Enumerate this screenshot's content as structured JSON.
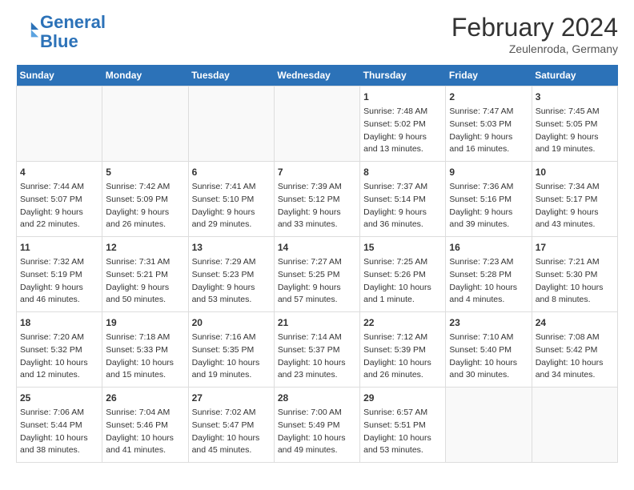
{
  "logo": {
    "line1": "General",
    "line2": "Blue"
  },
  "title": "February 2024",
  "subtitle": "Zeulenroda, Germany",
  "headers": [
    "Sunday",
    "Monday",
    "Tuesday",
    "Wednesday",
    "Thursday",
    "Friday",
    "Saturday"
  ],
  "weeks": [
    [
      {
        "day": "",
        "info": ""
      },
      {
        "day": "",
        "info": ""
      },
      {
        "day": "",
        "info": ""
      },
      {
        "day": "",
        "info": ""
      },
      {
        "day": "1",
        "info": "Sunrise: 7:48 AM\nSunset: 5:02 PM\nDaylight: 9 hours\nand 13 minutes."
      },
      {
        "day": "2",
        "info": "Sunrise: 7:47 AM\nSunset: 5:03 PM\nDaylight: 9 hours\nand 16 minutes."
      },
      {
        "day": "3",
        "info": "Sunrise: 7:45 AM\nSunset: 5:05 PM\nDaylight: 9 hours\nand 19 minutes."
      }
    ],
    [
      {
        "day": "4",
        "info": "Sunrise: 7:44 AM\nSunset: 5:07 PM\nDaylight: 9 hours\nand 22 minutes."
      },
      {
        "day": "5",
        "info": "Sunrise: 7:42 AM\nSunset: 5:09 PM\nDaylight: 9 hours\nand 26 minutes."
      },
      {
        "day": "6",
        "info": "Sunrise: 7:41 AM\nSunset: 5:10 PM\nDaylight: 9 hours\nand 29 minutes."
      },
      {
        "day": "7",
        "info": "Sunrise: 7:39 AM\nSunset: 5:12 PM\nDaylight: 9 hours\nand 33 minutes."
      },
      {
        "day": "8",
        "info": "Sunrise: 7:37 AM\nSunset: 5:14 PM\nDaylight: 9 hours\nand 36 minutes."
      },
      {
        "day": "9",
        "info": "Sunrise: 7:36 AM\nSunset: 5:16 PM\nDaylight: 9 hours\nand 39 minutes."
      },
      {
        "day": "10",
        "info": "Sunrise: 7:34 AM\nSunset: 5:17 PM\nDaylight: 9 hours\nand 43 minutes."
      }
    ],
    [
      {
        "day": "11",
        "info": "Sunrise: 7:32 AM\nSunset: 5:19 PM\nDaylight: 9 hours\nand 46 minutes."
      },
      {
        "day": "12",
        "info": "Sunrise: 7:31 AM\nSunset: 5:21 PM\nDaylight: 9 hours\nand 50 minutes."
      },
      {
        "day": "13",
        "info": "Sunrise: 7:29 AM\nSunset: 5:23 PM\nDaylight: 9 hours\nand 53 minutes."
      },
      {
        "day": "14",
        "info": "Sunrise: 7:27 AM\nSunset: 5:25 PM\nDaylight: 9 hours\nand 57 minutes."
      },
      {
        "day": "15",
        "info": "Sunrise: 7:25 AM\nSunset: 5:26 PM\nDaylight: 10 hours\nand 1 minute."
      },
      {
        "day": "16",
        "info": "Sunrise: 7:23 AM\nSunset: 5:28 PM\nDaylight: 10 hours\nand 4 minutes."
      },
      {
        "day": "17",
        "info": "Sunrise: 7:21 AM\nSunset: 5:30 PM\nDaylight: 10 hours\nand 8 minutes."
      }
    ],
    [
      {
        "day": "18",
        "info": "Sunrise: 7:20 AM\nSunset: 5:32 PM\nDaylight: 10 hours\nand 12 minutes."
      },
      {
        "day": "19",
        "info": "Sunrise: 7:18 AM\nSunset: 5:33 PM\nDaylight: 10 hours\nand 15 minutes."
      },
      {
        "day": "20",
        "info": "Sunrise: 7:16 AM\nSunset: 5:35 PM\nDaylight: 10 hours\nand 19 minutes."
      },
      {
        "day": "21",
        "info": "Sunrise: 7:14 AM\nSunset: 5:37 PM\nDaylight: 10 hours\nand 23 minutes."
      },
      {
        "day": "22",
        "info": "Sunrise: 7:12 AM\nSunset: 5:39 PM\nDaylight: 10 hours\nand 26 minutes."
      },
      {
        "day": "23",
        "info": "Sunrise: 7:10 AM\nSunset: 5:40 PM\nDaylight: 10 hours\nand 30 minutes."
      },
      {
        "day": "24",
        "info": "Sunrise: 7:08 AM\nSunset: 5:42 PM\nDaylight: 10 hours\nand 34 minutes."
      }
    ],
    [
      {
        "day": "25",
        "info": "Sunrise: 7:06 AM\nSunset: 5:44 PM\nDaylight: 10 hours\nand 38 minutes."
      },
      {
        "day": "26",
        "info": "Sunrise: 7:04 AM\nSunset: 5:46 PM\nDaylight: 10 hours\nand 41 minutes."
      },
      {
        "day": "27",
        "info": "Sunrise: 7:02 AM\nSunset: 5:47 PM\nDaylight: 10 hours\nand 45 minutes."
      },
      {
        "day": "28",
        "info": "Sunrise: 7:00 AM\nSunset: 5:49 PM\nDaylight: 10 hours\nand 49 minutes."
      },
      {
        "day": "29",
        "info": "Sunrise: 6:57 AM\nSunset: 5:51 PM\nDaylight: 10 hours\nand 53 minutes."
      },
      {
        "day": "",
        "info": ""
      },
      {
        "day": "",
        "info": ""
      }
    ]
  ]
}
